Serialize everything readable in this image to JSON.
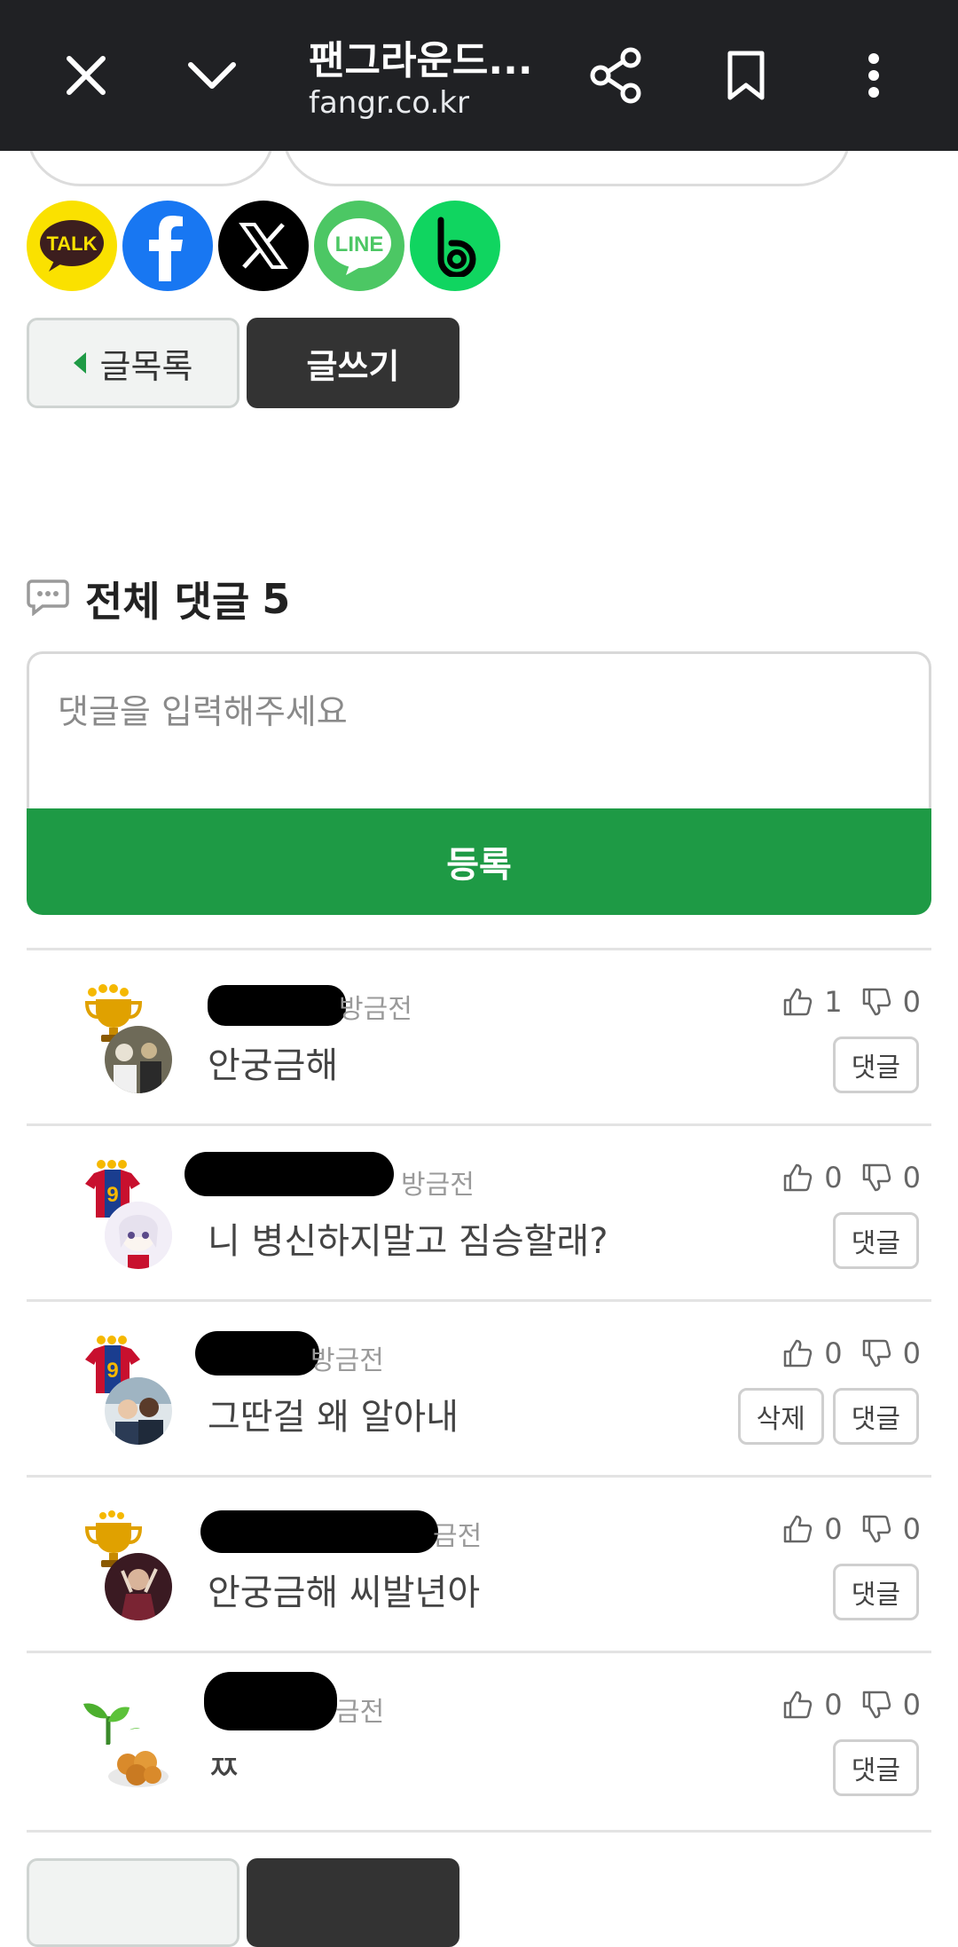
{
  "browser": {
    "title": "팬그라운드...",
    "url": "fangr.co.kr"
  },
  "share": [
    "kakaotalk-icon",
    "facebook-icon",
    "x-icon",
    "line-icon",
    "band-icon"
  ],
  "buttons": {
    "list_label": "글목록",
    "write_label": "글쓰기"
  },
  "comments": {
    "title": "전체 댓글",
    "count": "5",
    "placeholder": "댓글을 입력해주세요",
    "submit_label": "등록",
    "items": [
      {
        "author": "",
        "time": "방금전",
        "text": "안궁금해",
        "likes": "1",
        "dislikes": "0",
        "actions": [
          "댓글"
        ],
        "badge": "trophy"
      },
      {
        "author": "",
        "time": "방금전",
        "text": "니 병신하지말고 짐승할래?",
        "likes": "0",
        "dislikes": "0",
        "actions": [
          "댓글"
        ],
        "badge": "jersey"
      },
      {
        "author": "",
        "time": "방금전",
        "text": "그딴걸 왜 알아내",
        "likes": "0",
        "dislikes": "0",
        "actions": [
          "삭제",
          "댓글"
        ],
        "badge": "jersey"
      },
      {
        "author": "",
        "time": "금전",
        "text": "안궁금해 씨발년아",
        "likes": "0",
        "dislikes": "0",
        "actions": [
          "댓글"
        ],
        "badge": "trophy"
      },
      {
        "author": "",
        "time": "금전",
        "text": "ㅉ",
        "likes": "0",
        "dislikes": "0",
        "actions": [
          "댓글"
        ],
        "badge": "sprout"
      }
    ]
  }
}
